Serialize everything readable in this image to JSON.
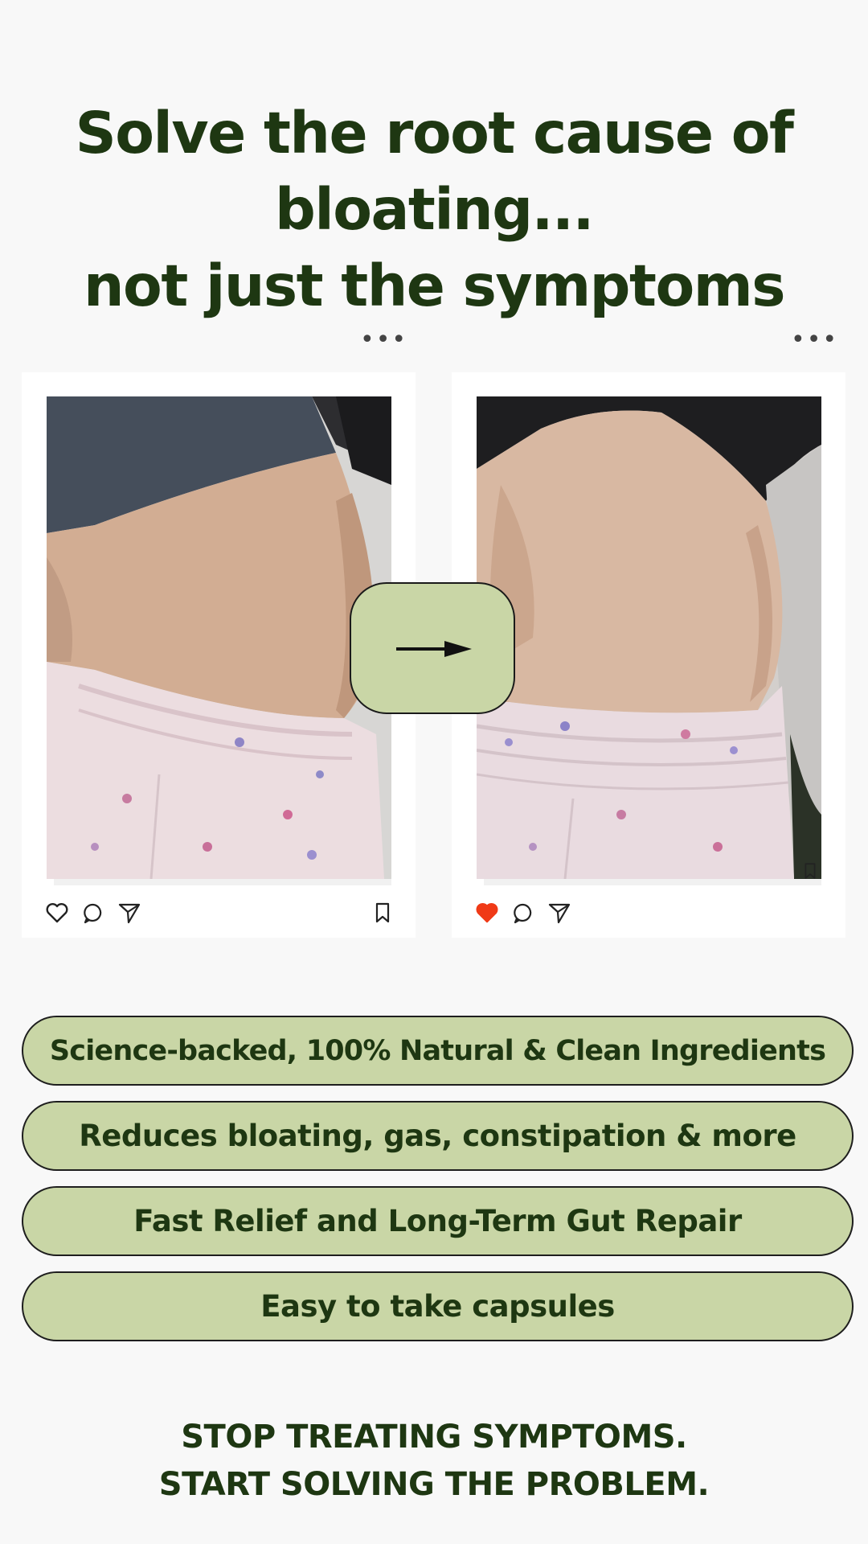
{
  "headline": {
    "line1": "Solve the root cause of",
    "line2": "bloating...",
    "line3": "not just the symptoms"
  },
  "posts": {
    "before": {
      "photo": "before-bloated-belly-photo",
      "liked": false,
      "more_icon": "more-horizontal-icon",
      "icons": [
        "heart-outline-icon",
        "comment-icon",
        "send-icon",
        "bookmark-icon"
      ]
    },
    "after": {
      "photo": "after-flat-belly-photo",
      "liked": true,
      "more_icon": "more-horizontal-icon",
      "icons": [
        "heart-filled-icon",
        "comment-icon",
        "send-icon",
        "bookmark-icon"
      ]
    },
    "more_dots": "•••"
  },
  "transition": {
    "icon": "arrow-right-icon"
  },
  "benefits": [
    "Science-backed, 100% Natural & Clean Ingredients",
    "Reduces bloating, gas, constipation & more",
    "Fast Relief and Long-Term Gut Repair",
    "Easy to take capsules"
  ],
  "cta": {
    "line1": "STOP TREATING SYMPTOMS.",
    "line2": "START SOLVING THE PROBLEM."
  },
  "colors": {
    "heading": "#1e3712",
    "pill_fill": "#c9d6a6",
    "background": "#f8f8f8",
    "like_red": "#f03a17"
  }
}
